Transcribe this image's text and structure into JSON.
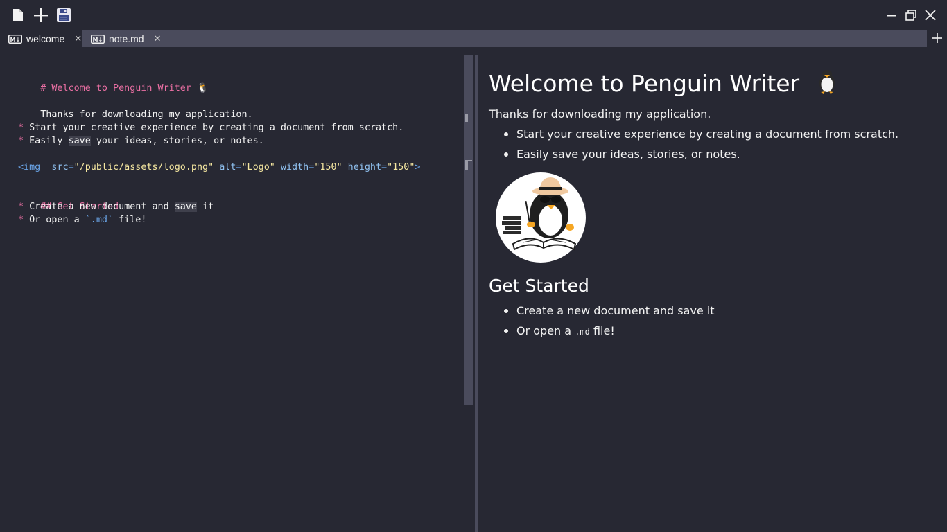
{
  "app": {
    "toolbar": {
      "new_file_icon": "file-icon",
      "add_icon": "plus-icon",
      "save_icon": "floppy-disk-icon"
    },
    "window_controls": {
      "minimize": "minimize-icon",
      "restore": "restore-icon",
      "close": "close-icon"
    }
  },
  "tabs": [
    {
      "icon": "markdown-icon",
      "icon_text": "M↓",
      "label": "welcome",
      "active": true
    },
    {
      "icon": "markdown-icon",
      "icon_text": "M↓",
      "label": "note.md",
      "active": false
    }
  ],
  "editor": {
    "lines": {
      "l1": "# Welcome to Penguin Writer 🐧",
      "l2": "Thanks for downloading my application.",
      "l3_bullet": "*",
      "l3_text": "Start your creative experience by creating a document from scratch.",
      "l4_bullet": "*",
      "l4_pre": "Easily ",
      "l4_hl": "save",
      "l4_post": " your ideas, stories, or notes.",
      "l5_tag": "<img",
      "l5_a1": "src",
      "l5_eq1": "=",
      "l5_v1": "\"/public/assets/logo.png\"",
      "l5_a2": "alt",
      "l5_eq2": "=",
      "l5_v2": "\"Logo\"",
      "l5_a3": "width",
      "l5_eq3": "=",
      "l5_v3": "\"150\"",
      "l5_a4": "height",
      "l5_eq4": "=",
      "l5_v4": "\"150\"",
      "l5_close": ">",
      "l6": "## Get Started",
      "l7_bullet": "*",
      "l7_pre": "Create a new document and ",
      "l7_hl": "save",
      "l7_post": " it",
      "l8_bullet": "*",
      "l8_pre": "Or open a ",
      "l8_code": "`.md`",
      "l8_post": " file!"
    }
  },
  "preview": {
    "h1": "Welcome to Penguin Writer",
    "h1_emoji": "penguin-icon",
    "p1": "Thanks for downloading my application.",
    "list1": [
      "Start your creative experience by creating a document from scratch.",
      "Easily save your ideas, stories, or notes."
    ],
    "logo_alt": "Logo",
    "h2": "Get Started",
    "list2_item1": "Create a new document and save it",
    "list2_item2_pre": "Or open a ",
    "list2_item2_code": ".md",
    "list2_item2_post": " file!"
  },
  "colors": {
    "background": "#272833",
    "tabbar": "#4a4b5c",
    "heading_pink": "#ea6fa3",
    "tag_blue": "#6aa4e6",
    "string_yellow": "#f5e7a0"
  }
}
